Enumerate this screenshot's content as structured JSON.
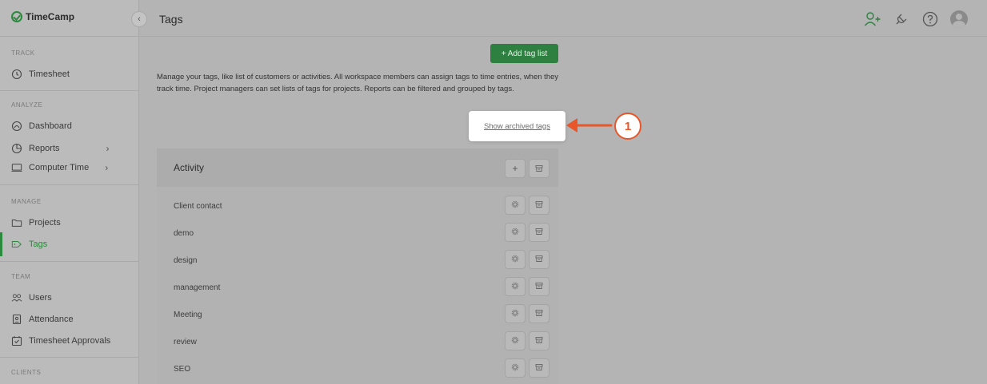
{
  "app": {
    "logo_text": "TimeCamp",
    "collapse_glyph": "‹"
  },
  "sidebar": {
    "sections": [
      {
        "label": "TRACK",
        "items": [
          {
            "label": "Timesheet",
            "icon": "clock-icon"
          }
        ]
      },
      {
        "label": "ANALYZE",
        "items": [
          {
            "label": "Dashboard",
            "icon": "dashboard-icon"
          },
          {
            "label": "Reports",
            "icon": "reports-icon",
            "has_submenu": true
          },
          {
            "label": "Computer Time",
            "icon": "monitor-icon",
            "has_submenu": true
          }
        ]
      },
      {
        "label": "MANAGE",
        "items": [
          {
            "label": "Projects",
            "icon": "folder-icon"
          },
          {
            "label": "Tags",
            "icon": "tag-icon",
            "active": true
          }
        ]
      },
      {
        "label": "TEAM",
        "items": [
          {
            "label": "Users",
            "icon": "users-icon"
          },
          {
            "label": "Attendance",
            "icon": "badge-icon"
          },
          {
            "label": "Timesheet Approvals",
            "icon": "calendar-check-icon"
          }
        ]
      },
      {
        "label": "CLIENTS",
        "items": []
      }
    ],
    "submenu_glyph": "›"
  },
  "header": {
    "title": "Tags"
  },
  "main": {
    "add_button_label": "+ Add tag list",
    "description": "Manage your tags, like list of customers or activities. All workspace members can assign tags to time entries, when they track time. Project managers can set lists of tags for projects. Reports can be filtered and grouped by tags.",
    "archived_link": "Show archived tags",
    "step_number": "1",
    "tag_list": {
      "title": "Activity",
      "add_glyph": "+",
      "tags": [
        "Client contact",
        "demo",
        "design",
        "management",
        "Meeting",
        "review",
        "SEO"
      ]
    }
  },
  "colors": {
    "accent_green": "#2e8040",
    "callout_orange": "#e8562a"
  }
}
